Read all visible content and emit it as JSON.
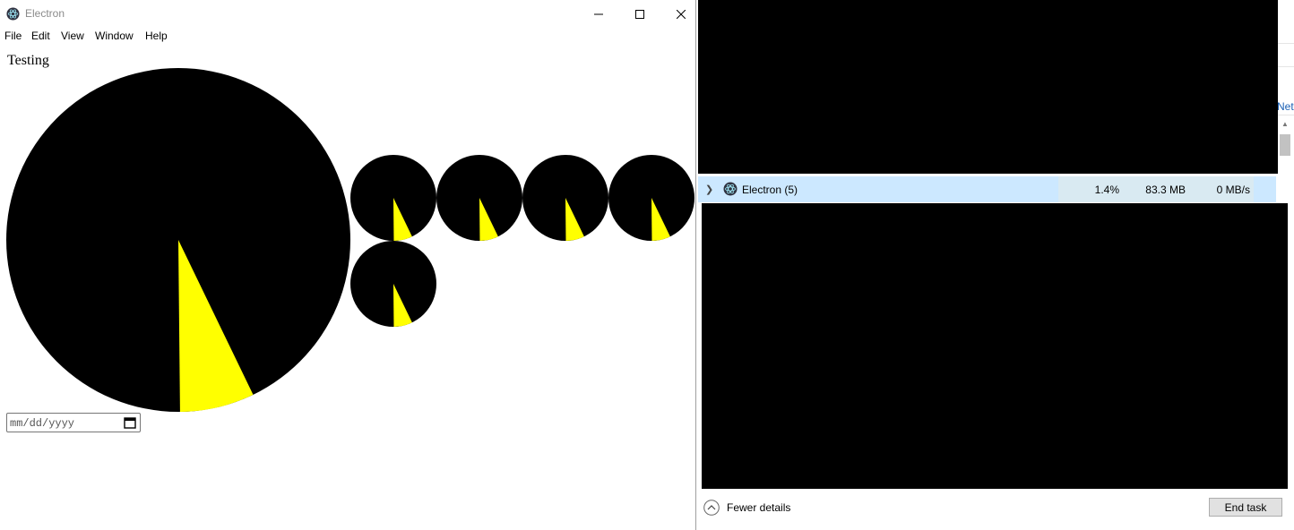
{
  "electron": {
    "window_title": "Electron",
    "menu": [
      "File",
      "Edit",
      "View",
      "Window",
      "Help"
    ],
    "heading": "Testing",
    "date_placeholder": "mm/dd/yyyy",
    "pie_colors": {
      "fill": "#000000",
      "slice": "#ffff00"
    },
    "pie_slice_fraction": 0.07
  },
  "task_manager": {
    "process": {
      "name": "Electron (5)",
      "cpu": "1.4%",
      "memory": "83.3 MB",
      "disk": "0 MB/s"
    },
    "column_partial": "Net",
    "footer": {
      "fewer_details": "Fewer details",
      "end_task": "End task"
    }
  }
}
